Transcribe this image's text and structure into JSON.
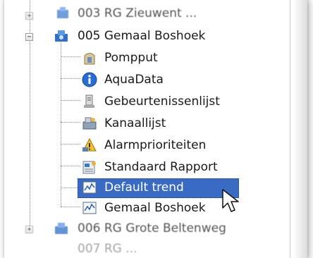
{
  "tree": {
    "items": [
      {
        "label": "003 RG Zieuwent ...",
        "level": 0,
        "expander": "+",
        "icon": "pump-station-icon"
      },
      {
        "label": "005 Gemaal Boshoek",
        "level": 0,
        "expander": "−",
        "icon": "pump-station-icon"
      },
      {
        "label": "Pompput",
        "level": 1,
        "icon": "pump-pit-icon"
      },
      {
        "label": "AquaData",
        "level": 1,
        "icon": "info-icon"
      },
      {
        "label": "Gebeurtenissenlijst",
        "level": 1,
        "icon": "event-list-icon"
      },
      {
        "label": "Kanaallijst",
        "level": 1,
        "icon": "channel-list-icon"
      },
      {
        "label": "Alarmprioriteiten",
        "level": 1,
        "icon": "alarm-priority-icon"
      },
      {
        "label": "Standaard Rapport",
        "level": 1,
        "icon": "report-icon"
      },
      {
        "label": "Default trend",
        "level": 1,
        "icon": "trend-icon",
        "selected": true
      },
      {
        "label": "Gemaal Boshoek",
        "level": 1,
        "icon": "trend-icon"
      },
      {
        "label": "006 RG Grote Beltenweg",
        "level": 0,
        "expander": "+",
        "icon": "pump-station-icon"
      },
      {
        "label": "007 RG ...",
        "level": 0,
        "icon": "pump-station-icon"
      }
    ]
  },
  "colors": {
    "selection": "#3a6bc4",
    "selection_text": "#ffffff",
    "text": "#1a1a1a"
  }
}
